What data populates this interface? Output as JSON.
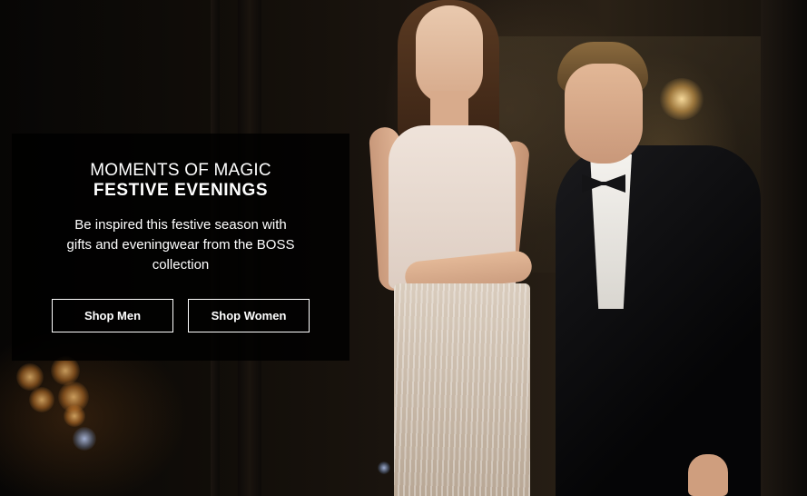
{
  "promo": {
    "eyebrow": "MOMENTS OF MAGIC",
    "title": "FESTIVE EVENINGS",
    "body": "Be inspired this festive season with gifts and eveningwear from the BOSS collection",
    "buttons": {
      "shop_men": "Shop Men",
      "shop_women": "Shop Women"
    }
  },
  "colors": {
    "overlay": "#000000",
    "text": "#ffffff",
    "button_border": "#ffffff"
  }
}
